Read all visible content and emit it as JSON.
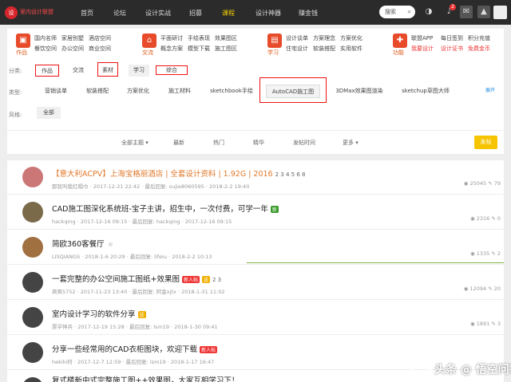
{
  "topbar": {
    "logo_mark": "设",
    "logo_text": "室内设计联盟",
    "nav": [
      "首页",
      "论坛",
      "设计实战",
      "招募",
      "课程",
      "设计神器",
      "赚金钱"
    ],
    "search_label": "搜索",
    "notification_count": "2"
  },
  "categories": [
    {
      "name": "作品",
      "links": [
        "国内名师",
        "家居别墅",
        "酒店空间",
        "餐饮空间",
        "办公空间",
        "商业空间"
      ],
      "color": "#e84b2a"
    },
    {
      "name": "交流",
      "links": [
        "平面研讨",
        "手绘表现",
        "效果图区",
        "概念方案",
        "模型下载",
        "施工图区"
      ],
      "color": "#e84b2a"
    },
    {
      "name": "学习",
      "links": [
        "设计谈单",
        "方案理念",
        "方案优化",
        "住宅设计",
        "软装搭配",
        "实用软件"
      ],
      "color": "#e84b2a"
    },
    {
      "name": "功能",
      "links": [
        "联盟APP",
        "每日签到",
        "积分充值",
        "我要设计",
        "设计证书",
        "免费金币"
      ],
      "color": "#e84b2a"
    }
  ],
  "filters": {
    "row1_label": "分类:",
    "row1": [
      "作品",
      "交流",
      "素材",
      "学习",
      "综合"
    ],
    "row2_label": "类型:",
    "row2": [
      "营销谈单",
      "软装搭配",
      "方案优化",
      "施工材料",
      "sketchbook手绘",
      "AutoCAD施工图",
      "3DMax效果图渲染",
      "sketchup草图大师"
    ],
    "row3_label": "风格:",
    "row3": [
      "全部"
    ],
    "expand": "展开"
  },
  "sortbar": {
    "items": [
      "全部主题",
      "最新",
      "热门",
      "精华",
      "发帖时间",
      "更多"
    ],
    "post_button": "发帖"
  },
  "posts": [
    {
      "title": "【意大利ACPV】上海宝格丽酒店 | 全套设计资料 | 1.92G | 2016",
      "pages": "2 3 4 5 6 8",
      "author": "那就叫我红帽巾",
      "date": "2017-12-21 22:42",
      "reply_label": "最后回复",
      "last": "sujie8060595",
      "last_date": "2018-2-2 19:40",
      "views": "25045",
      "replies": "79",
      "color": "#c77"
    },
    {
      "title": "CAD施工图深化系统班-宝子主讲，招生中，一次付费，可学一年",
      "author": "hackqing",
      "date": "2017-12-16 09:15",
      "reply_label": "最后回复",
      "last": "hackqing",
      "last_date": "2017-12-16 09:15",
      "views": "2316",
      "replies": "0",
      "color": "#7a6a4a"
    },
    {
      "title": "简欧360客餐厅",
      "author": "LISQIANGS",
      "date": "2018-1-6 20:29",
      "reply_label": "最后回复",
      "last": "lifeiu",
      "last_date": "2018-2-2 10:13",
      "views": "1335",
      "replies": "2",
      "color": "#a07040"
    },
    {
      "title": "一套完整的办公空间施工图纸+效果图",
      "pages": "2 3",
      "author": "爽爽5752",
      "date": "2017-11-23 13:40",
      "reply_label": "最后回复",
      "last": "阿金xjtx",
      "last_date": "2018-1-31 11:02",
      "views": "12094",
      "replies": "20",
      "color": "#444"
    },
    {
      "title": "室内设计学习的软件分享",
      "author": "厚学神兵",
      "date": "2017-12-19 15:28",
      "reply_label": "最后回复",
      "last": "lsm19",
      "last_date": "2018-1-30 09:41",
      "views": "1891",
      "replies": "3",
      "color": "#444"
    },
    {
      "title": "分享一些经常用的CAD衣柜图块，欢迎下载",
      "author": "hekiki何",
      "date": "2017-12-7 12:59",
      "reply_label": "最后回复",
      "last": "lsm19",
      "last_date": "2018-1-17 16:47",
      "views": "",
      "replies": "",
      "color": "#444"
    },
    {
      "title": "复式楼新中式完整施工图++效果图，大家互相学习下！",
      "author": "",
      "date": "",
      "reply_label": "",
      "last": "",
      "last_date": "",
      "views": "",
      "replies": "",
      "color": "#444"
    }
  ],
  "tags": {
    "recommend": "新人帖",
    "gift": "送",
    "new": "新"
  },
  "watermark": "头条 @ 悟空问答"
}
